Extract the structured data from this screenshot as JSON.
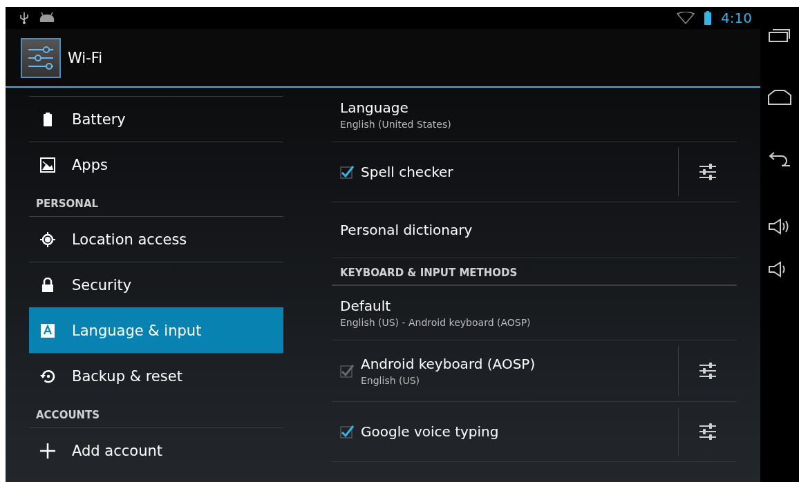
{
  "status_bar": {
    "time": "4:10"
  },
  "action_bar": {
    "title": "Wi-Fi"
  },
  "sidebar": {
    "items": [
      {
        "kind": "item",
        "label": "Battery",
        "selected": false
      },
      {
        "kind": "item",
        "label": "Apps",
        "selected": false
      },
      {
        "kind": "header",
        "label": "PERSONAL"
      },
      {
        "kind": "item",
        "label": "Location access",
        "selected": false
      },
      {
        "kind": "item",
        "label": "Security",
        "selected": false
      },
      {
        "kind": "item",
        "label": "Language & input",
        "selected": true
      },
      {
        "kind": "item",
        "label": "Backup & reset",
        "selected": false
      },
      {
        "kind": "header",
        "label": "ACCOUNTS"
      },
      {
        "kind": "item",
        "label": "Add account",
        "selected": false
      }
    ]
  },
  "preferences": [
    {
      "kind": "pref",
      "title": "Language",
      "summary": "English (United States)"
    },
    {
      "kind": "checkbox",
      "title": "Spell checker",
      "checked": true,
      "disabled": false
    },
    {
      "kind": "pref",
      "title": "Personal dictionary"
    },
    {
      "kind": "header",
      "title": "KEYBOARD & INPUT METHODS"
    },
    {
      "kind": "pref",
      "title": "Default",
      "summary": "English (US) - Android keyboard (AOSP)"
    },
    {
      "kind": "checkbox",
      "title": "Android keyboard (AOSP)",
      "summary": "English (US)",
      "checked": true,
      "disabled": true
    },
    {
      "kind": "checkbox",
      "title": "Google voice typing",
      "checked": true,
      "disabled": false
    }
  ]
}
